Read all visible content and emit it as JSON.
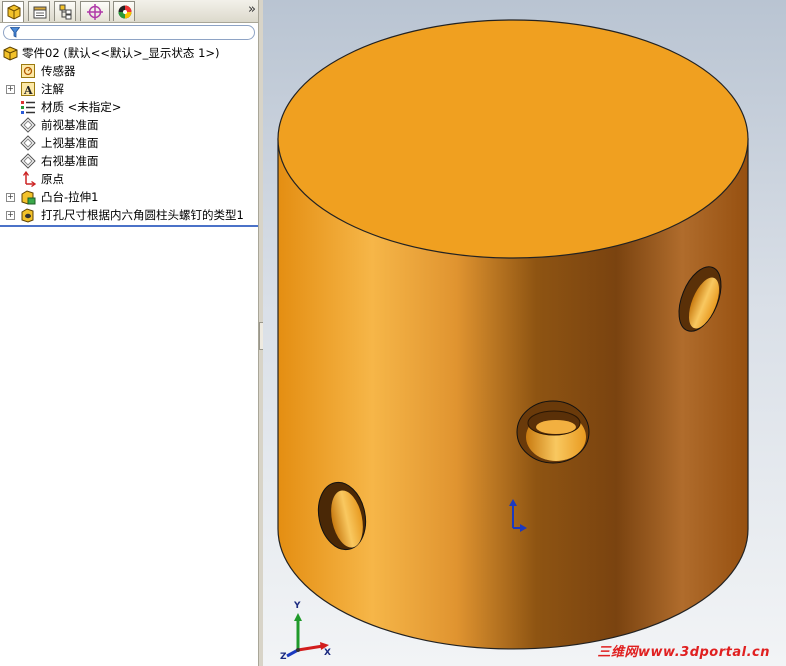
{
  "panel": {
    "tabs": [
      {
        "name": "feature-manager",
        "icon": "feature-tree-icon"
      },
      {
        "name": "property-manager",
        "icon": "property-manager-icon"
      },
      {
        "name": "configuration-manager",
        "icon": "configuration-icon"
      },
      {
        "name": "dimxpert-manager",
        "icon": "crosshair-icon"
      },
      {
        "name": "display-manager",
        "icon": "color-wheel-icon"
      }
    ],
    "overflow_label": "»",
    "filter_icon": "filter-icon"
  },
  "tree": {
    "root": {
      "label": "零件02   (默认<<默认>_显示状态 1>)",
      "icon": "part-icon"
    },
    "items": [
      {
        "label": "传感器",
        "icon": "sensor-icon",
        "expandable": false
      },
      {
        "label": "注解",
        "icon": "annotation-icon",
        "expandable": true
      },
      {
        "label": "材质 <未指定>",
        "icon": "material-icon",
        "expandable": false
      },
      {
        "label": "前视基准面",
        "icon": "plane-icon",
        "expandable": false
      },
      {
        "label": "上视基准面",
        "icon": "plane-icon",
        "expandable": false
      },
      {
        "label": "右视基准面",
        "icon": "plane-icon",
        "expandable": false
      },
      {
        "label": "原点",
        "icon": "origin-icon",
        "expandable": false
      },
      {
        "label": "凸台-拉伸1",
        "icon": "boss-extrude-icon",
        "expandable": true
      },
      {
        "label": "打孔尺寸根据内六角圆柱头螺钉的类型1",
        "icon": "hole-wizard-icon",
        "expandable": true
      }
    ]
  },
  "viewport": {
    "model_color": "#f0a020",
    "triad_labels": {
      "x": "X",
      "y": "Y",
      "z": "Z"
    },
    "watermark": "三维网www.3dportal.cn"
  }
}
